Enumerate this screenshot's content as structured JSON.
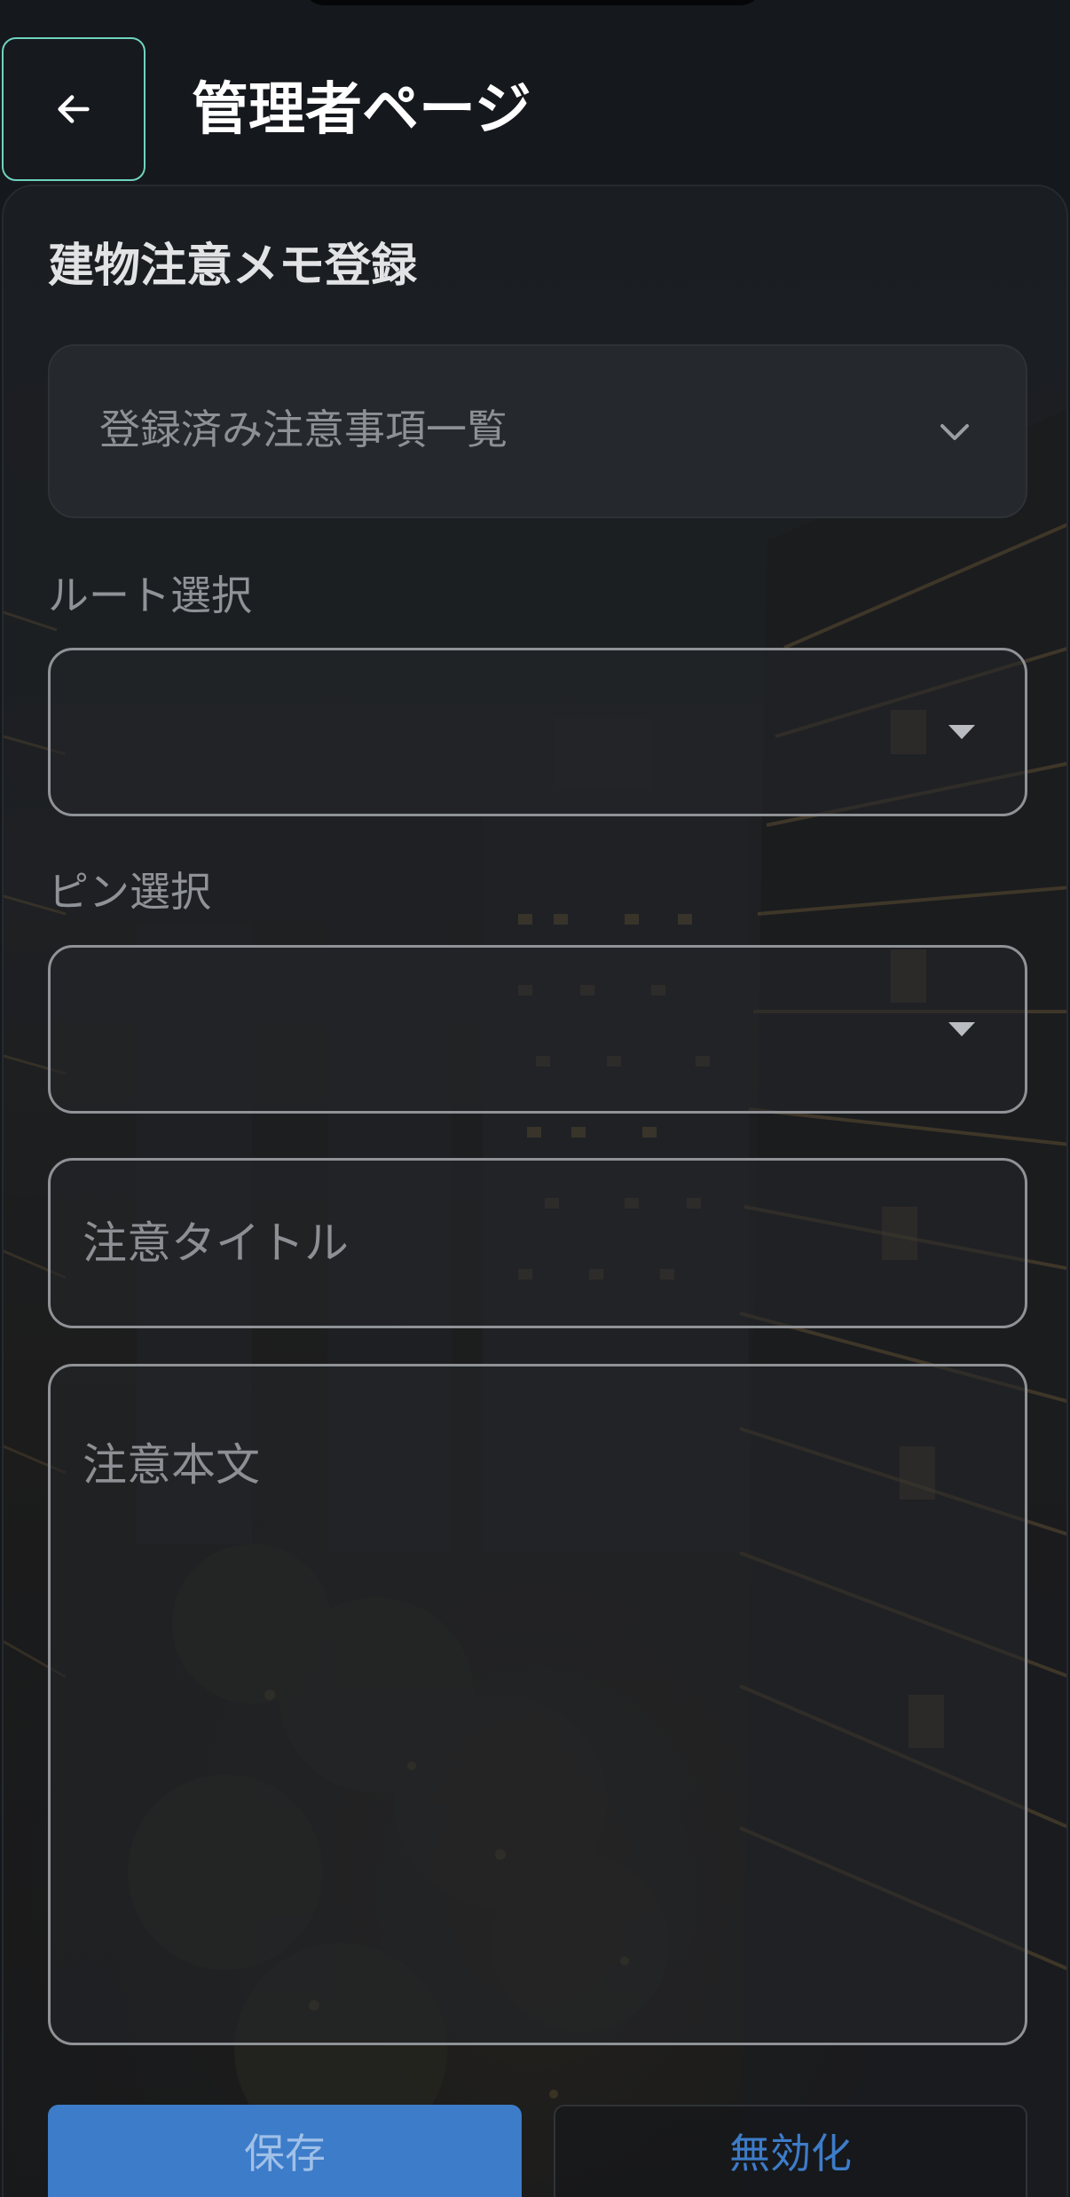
{
  "header": {
    "title": "管理者ページ",
    "back_icon": "arrow-left-icon",
    "accent_color": "#6fd3c0"
  },
  "card": {
    "title": "建物注意メモ登録",
    "registered_list": {
      "label": "登録済み注意事項一覧",
      "icon": "chevron-down-icon"
    },
    "route_select": {
      "label": "ルート選択",
      "value": ""
    },
    "pin_select": {
      "label": "ピン選択",
      "value": ""
    },
    "title_input": {
      "placeholder": "注意タイトル",
      "value": ""
    },
    "body_input": {
      "placeholder": "注意本文",
      "value": ""
    }
  },
  "actions": {
    "save_label": "保存",
    "disable_label": "無効化",
    "primary_color": "#3d7cc9"
  }
}
